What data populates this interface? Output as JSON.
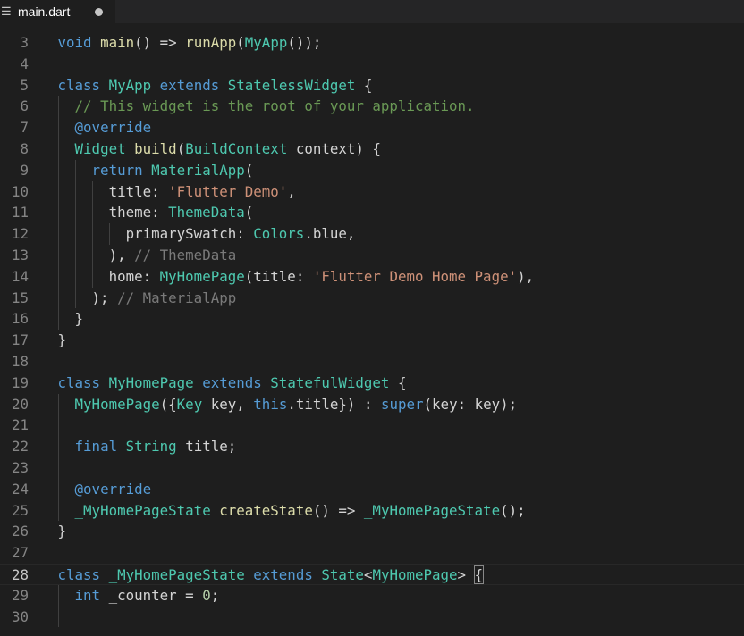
{
  "tab": {
    "icon": "menu-lines-icon",
    "filename": "main.dart"
  },
  "lines": [
    {
      "num": "3",
      "text": "void main() => runApp(MyApp());"
    },
    {
      "num": "4",
      "text": ""
    },
    {
      "num": "5",
      "text": "class MyApp extends StatelessWidget {"
    },
    {
      "num": "6",
      "text": "  // This widget is the root of your application."
    },
    {
      "num": "7",
      "text": "  @override"
    },
    {
      "num": "8",
      "text": "  Widget build(BuildContext context) {"
    },
    {
      "num": "9",
      "text": "    return MaterialApp("
    },
    {
      "num": "10",
      "text": "      title: 'Flutter Demo',"
    },
    {
      "num": "11",
      "text": "      theme: ThemeData("
    },
    {
      "num": "12",
      "text": "        primarySwatch: Colors.blue,"
    },
    {
      "num": "13",
      "text": "      ), // ThemeData"
    },
    {
      "num": "14",
      "text": "      home: MyHomePage(title: 'Flutter Demo Home Page'),"
    },
    {
      "num": "15",
      "text": "    ); // MaterialApp"
    },
    {
      "num": "16",
      "text": "  }"
    },
    {
      "num": "17",
      "text": "}"
    },
    {
      "num": "18",
      "text": ""
    },
    {
      "num": "19",
      "text": "class MyHomePage extends StatefulWidget {"
    },
    {
      "num": "20",
      "text": "  MyHomePage({Key key, this.title}) : super(key: key);"
    },
    {
      "num": "21",
      "text": ""
    },
    {
      "num": "22",
      "text": "  final String title;"
    },
    {
      "num": "23",
      "text": ""
    },
    {
      "num": "24",
      "text": "  @override"
    },
    {
      "num": "25",
      "text": "  _MyHomePageState createState() => _MyHomePageState();"
    },
    {
      "num": "26",
      "text": "}"
    },
    {
      "num": "27",
      "text": ""
    },
    {
      "num": "28",
      "text": "class _MyHomePageState extends State<MyHomePage> {"
    },
    {
      "num": "29",
      "text": "  int _counter = 0;"
    },
    {
      "num": "30",
      "text": ""
    }
  ],
  "current_line": "28"
}
